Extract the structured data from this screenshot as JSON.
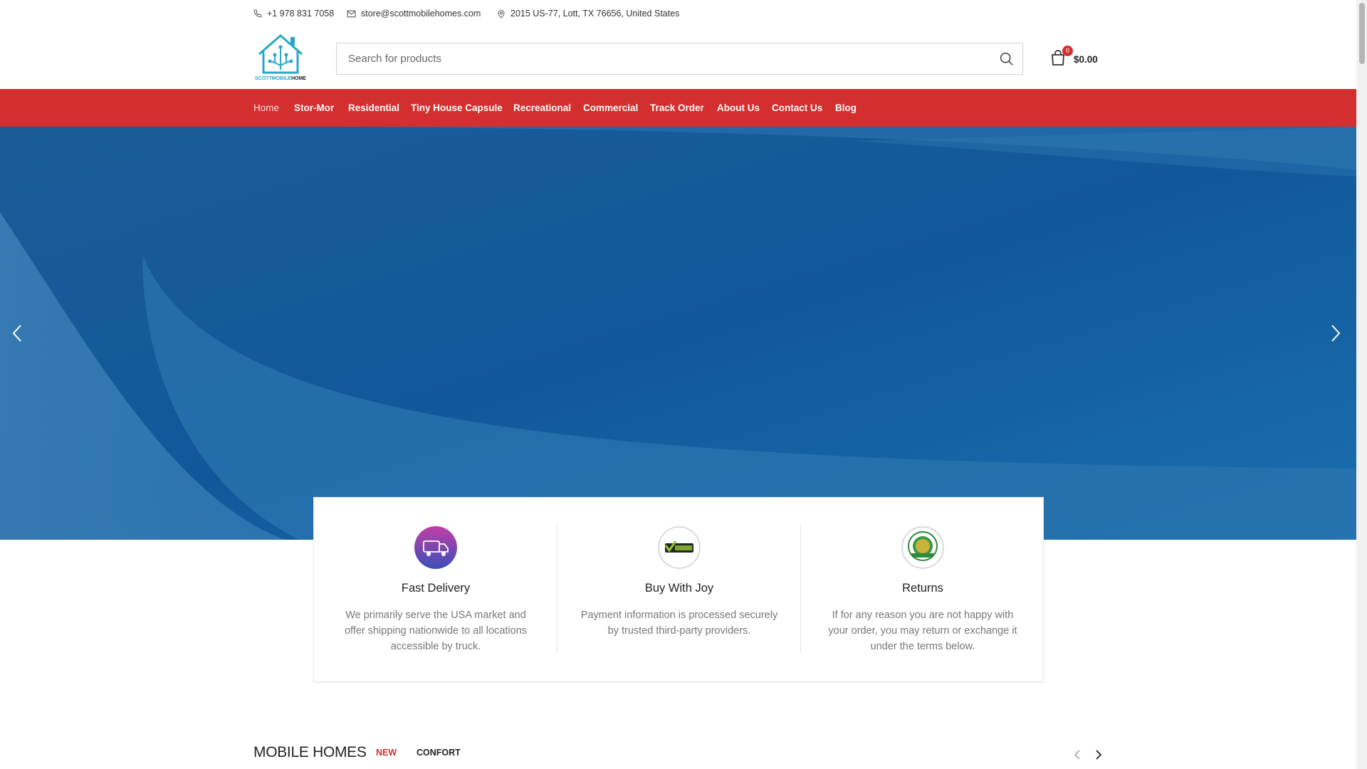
{
  "topbar": {
    "phone": "+1 978 831 7058",
    "email": "store@scottmobilehomes.com",
    "address": "2015 US-77, Lott, TX 76656, United States"
  },
  "header": {
    "logo_text": "SCOTTMOBILEHOME",
    "search_placeholder": "Search for products",
    "cart_count": "0",
    "cart_total": "$0.00"
  },
  "nav": {
    "items": [
      {
        "label": "Home",
        "active": true
      },
      {
        "label": "Stor-Mor"
      },
      {
        "label": "Residential"
      },
      {
        "label": "Tiny House Capsule"
      },
      {
        "label": "Recreational"
      },
      {
        "label": "Commercial"
      },
      {
        "label": "Track Order"
      },
      {
        "label": "About Us"
      },
      {
        "label": "Contact Us"
      },
      {
        "label": "Blog"
      }
    ]
  },
  "features": [
    {
      "icon": "delivery-truck-icon",
      "title": "Fast Delivery",
      "desc": "We primarily serve the USA market and offer shipping nationwide to all locations accessible by truck."
    },
    {
      "icon": "checkmark-badge-icon",
      "title": "Buy With Joy",
      "desc": "Payment information is processed securely by trusted third-party providers."
    },
    {
      "icon": "guarantee-seal-icon",
      "title": "Returns",
      "desc": "If for any reason you are not happy with your order, you may return or exchange it under the terms below."
    }
  ],
  "products_section": {
    "title": "MOBILE HOMES",
    "tabs": [
      "NEW",
      "CONFORT"
    ]
  },
  "colors": {
    "brand_red": "#d32f2f",
    "hero_blue": "#1f6aa6"
  }
}
